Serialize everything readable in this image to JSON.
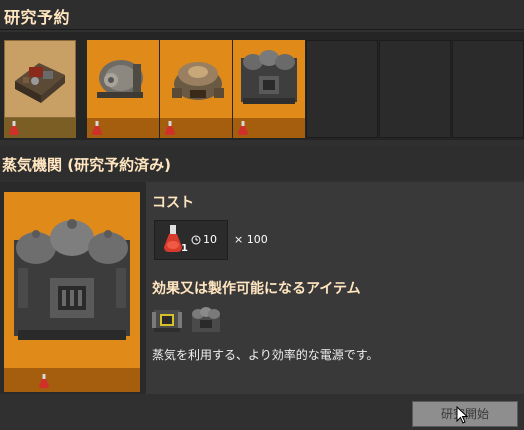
{
  "queue_header": {
    "title": "研究予約"
  },
  "queue": {
    "slots": [
      {
        "name": "queued-research-1",
        "style": "selected",
        "icon": "automation-machine-icon"
      },
      {
        "name": "queued-research-2",
        "style": "orange",
        "icon": "electric-motor-icon"
      },
      {
        "name": "queued-research-3",
        "style": "orange",
        "icon": "boiler-icon"
      },
      {
        "name": "queued-research-4",
        "style": "orange",
        "icon": "steam-engine-icon"
      }
    ],
    "empty_slots": 3,
    "science_pack_icon": "red-science-flask-icon"
  },
  "detail": {
    "title": "蒸気機関 (研究予約済み)",
    "cost_label": "コスト",
    "cost": {
      "ingredient_count": "1",
      "time": "10",
      "multiplier": "× 100"
    },
    "unlocks_label": "効果又は製作可能になるアイテム",
    "unlocks": [
      {
        "icon": "steam-engine-item-icon"
      },
      {
        "icon": "steam-turbine-item-icon"
      }
    ],
    "description": "蒸気を利用する、より効率的な電源です。"
  },
  "footer": {
    "start_button_label": "研究開始"
  },
  "colors": {
    "accent_orange": "#e08a1a",
    "header_text": "#ffe6c0",
    "button_disabled": "#8e8e8e"
  }
}
